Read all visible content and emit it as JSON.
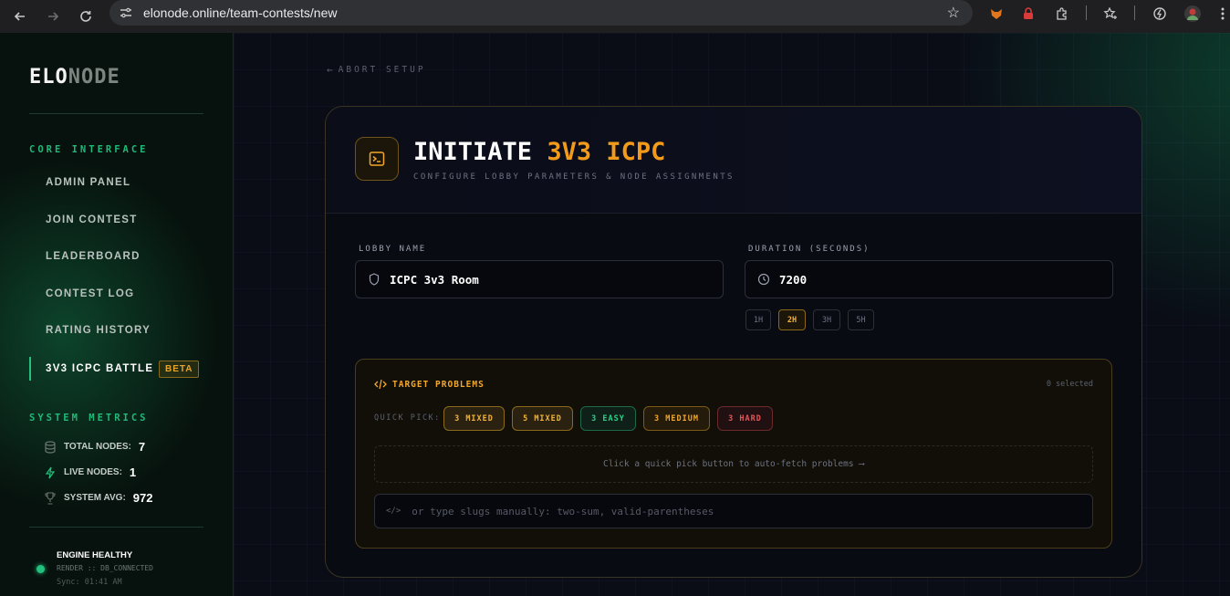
{
  "browser": {
    "url": "elonode.online/team-contests/new"
  },
  "sidebar": {
    "logo_bright": "ELO",
    "logo_dim": "NODE",
    "core_heading": "CORE INTERFACE",
    "items": [
      {
        "label": "ADMIN PANEL"
      },
      {
        "label": "JOIN CONTEST"
      },
      {
        "label": "LEADERBOARD"
      },
      {
        "label": "CONTEST LOG"
      },
      {
        "label": "RATING HISTORY"
      },
      {
        "label": "3V3 ICPC BATTLE",
        "active": true
      }
    ],
    "beta_badge": "BETA",
    "metrics_heading": "SYSTEM METRICS",
    "metrics": [
      {
        "label": "TOTAL NODES:",
        "value": "7",
        "icon": "database-icon"
      },
      {
        "label": "LIVE NODES:",
        "value": "1",
        "icon": "bolt-icon"
      },
      {
        "label": "SYSTEM AVG:",
        "value": "972",
        "icon": "trophy-icon"
      }
    ],
    "health": {
      "title": "ENGINE HEALTHY",
      "sub": "RENDER :: DB_CONNECTED",
      "sync": "Sync: 01:41 AM"
    }
  },
  "main": {
    "abort_label": "ABORT SETUP",
    "title_white": "INITIATE ",
    "title_orange": "3V3 ICPC",
    "subtitle": "CONFIGURE LOBBY PARAMETERS & NODE ASSIGNMENTS",
    "lobby_label": "LOBBY NAME",
    "lobby_value": "ICPC 3v3 Room",
    "duration_label": "DURATION (SECONDS)",
    "duration_value": "7200",
    "duration_chips": [
      "1H",
      "2H",
      "3H",
      "5H"
    ],
    "duration_selected": "2H",
    "problems": {
      "title": "TARGET PROBLEMS",
      "count": "0 selected",
      "quick_label": "QUICK PICK:",
      "quick_picks": [
        "3 MIXED",
        "5 MIXED",
        "3 EASY",
        "3 MEDIUM",
        "3 HARD"
      ],
      "empty_hint": "Click a quick pick button to auto-fetch problems ⟶",
      "slug_placeholder": "or type slugs manually: two-sum, valid-parentheses"
    }
  },
  "colors": {
    "accent_orange": "#f29a1a",
    "accent_green": "#22c27e",
    "hard_red": "#e0565a"
  }
}
